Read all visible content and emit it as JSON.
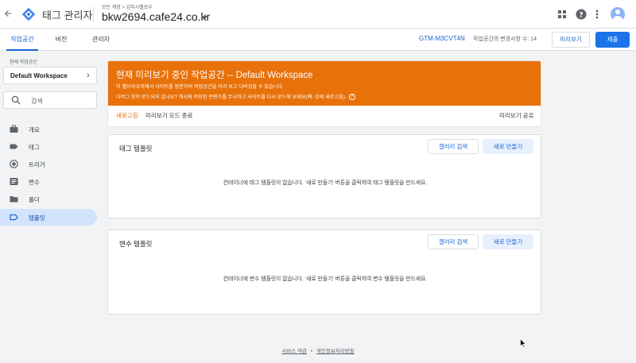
{
  "header": {
    "app_name": "태그 관리자",
    "breadcrumb": "모든 계정 > 김미시멜로우",
    "container_name": "bkw2694.cafe24.co.kr",
    "icons": [
      "back-arrow-icon",
      "gtm-logo",
      "apps-grid-icon",
      "help-icon",
      "more-vert-icon",
      "account-avatar"
    ]
  },
  "tabs": [
    {
      "label": "작업공간",
      "active": true
    },
    {
      "label": "버전",
      "active": false
    },
    {
      "label": "관리자",
      "active": false
    }
  ],
  "toolbar": {
    "container_id": "GTM-M3CVT4N",
    "changes_text": "작업공간의 변경사항 수: 14",
    "preview_label": "미리보기",
    "submit_label": "제출"
  },
  "sidebar": {
    "workspace_label": "현재 작업공간",
    "workspace_name": "Default Workspace",
    "search_placeholder": "검색",
    "items": [
      {
        "label": "개요",
        "icon": "briefcase-icon",
        "active": false
      },
      {
        "label": "태그",
        "icon": "tag-icon",
        "active": false
      },
      {
        "label": "트리거",
        "icon": "trigger-icon",
        "active": false
      },
      {
        "label": "변수",
        "icon": "variable-icon",
        "active": false
      },
      {
        "label": "폴더",
        "icon": "folder-icon",
        "active": false
      },
      {
        "label": "템플릿",
        "icon": "template-icon",
        "active": true
      }
    ]
  },
  "preview_banner": {
    "title": "현재 미리보기 중인 작업공간 -- Default Workspace",
    "desc1": "이 웹브라우저에서 사이트를 방문하여 작업공간을 미리 보고 디버깅할 수 있습니다.",
    "desc2": "디버그 창이 로드되지 않나요? 캐시에 저장된 콘텐츠를 무시하고 사이트를 다시 로드해 보세요(예: 강제 새로고침).",
    "refresh_label": "새로고침",
    "exit_label": "미리보기 모드 종료",
    "share_label": "미리보기 공유",
    "color": "#e8710a"
  },
  "tag_templates": {
    "title": "태그 템플릿",
    "gallery_label": "갤러리 검색",
    "new_label": "새로 만들기",
    "empty_text": "컨테이너에 태그 템플릿이 없습니다. '새로 만들기' 버튼을 클릭하여 태그 템플릿을 만드세요."
  },
  "variable_templates": {
    "title": "변수 템플릿",
    "gallery_label": "갤러리 검색",
    "new_label": "새로 만들기",
    "empty_text": "컨테이너에 변수 템플릿이 없습니다. '새로 만들기' 버튼을 클릭하여 변수 템플릿을 만드세요."
  },
  "footer": {
    "terms_label": "서비스 약관",
    "separator": "•",
    "privacy_label": "개인정보처리방침"
  },
  "colors": {
    "accent": "#1a73e8",
    "link": "#1967d2",
    "active_nav": "#d2e3fc"
  }
}
